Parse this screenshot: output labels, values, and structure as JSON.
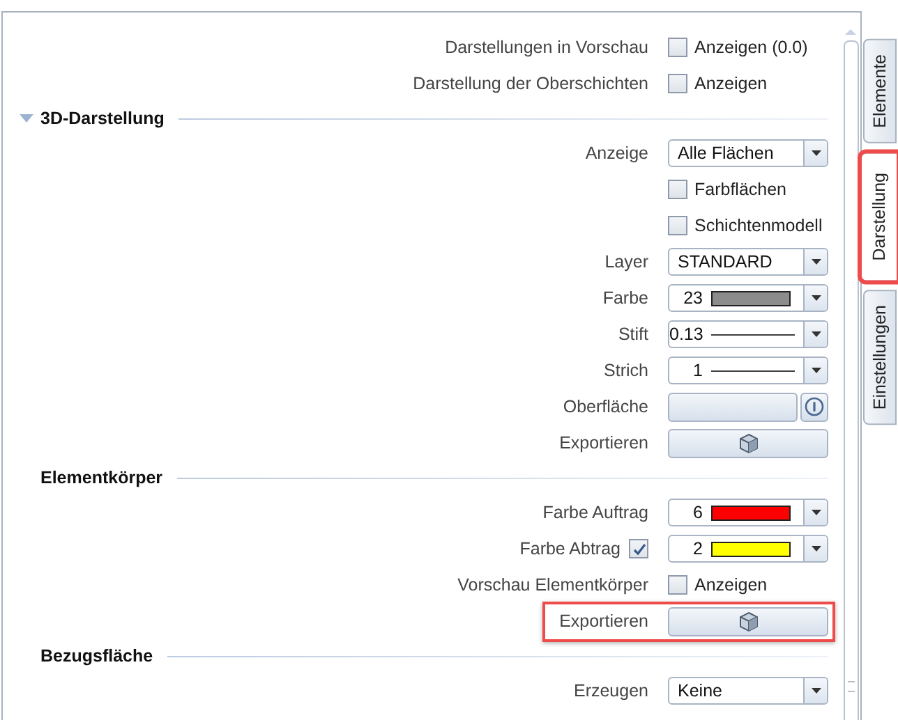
{
  "sections": [
    {
      "rows": [
        {
          "kind": "check",
          "label": "Darstellungen in Vorschau",
          "check_label": "Anzeigen (0.0)",
          "checked": false
        },
        {
          "kind": "check",
          "label": "Darstellung der Oberschichten",
          "check_label": "Anzeigen",
          "checked": false
        }
      ]
    },
    {
      "title": "3D-Darstellung",
      "expanded": true,
      "rows": [
        {
          "kind": "dropdown",
          "label": "Anzeige",
          "value": "Alle Flächen"
        },
        {
          "kind": "check",
          "check_label": "Farbflächen",
          "checked": false
        },
        {
          "kind": "check",
          "check_label": "Schichtenmodell",
          "checked": false
        },
        {
          "kind": "dropdown",
          "label": "Layer",
          "value": "STANDARD"
        },
        {
          "kind": "color",
          "label": "Farbe",
          "value": "23",
          "color": "#8c8c8c"
        },
        {
          "kind": "line",
          "label": "Stift",
          "value": "0.13"
        },
        {
          "kind": "line",
          "label": "Strich",
          "value": "1"
        },
        {
          "kind": "surface",
          "label": "Oberfläche"
        },
        {
          "kind": "export",
          "label": "Exportieren",
          "highlighted": false
        }
      ]
    },
    {
      "title": "Elementkörper",
      "rows": [
        {
          "kind": "color",
          "label": "Farbe Auftrag",
          "value": "6",
          "color": "#ff0000"
        },
        {
          "kind": "color",
          "label": "Farbe Abtrag",
          "value": "2",
          "color": "#ffff00",
          "label_checked": true
        },
        {
          "kind": "check",
          "label": "Vorschau Elementkörper",
          "check_label": "Anzeigen",
          "checked": false
        },
        {
          "kind": "export",
          "label": "Exportieren",
          "highlighted": true
        }
      ]
    },
    {
      "title": "Bezugsfläche",
      "rows": [
        {
          "kind": "dropdown",
          "label": "Erzeugen",
          "value": "Keine"
        }
      ]
    }
  ],
  "tabs": [
    {
      "label": "Elemente",
      "selected": false,
      "highlighted": false
    },
    {
      "label": "Darstellung",
      "selected": true,
      "highlighted": true
    },
    {
      "label": "Einstellungen",
      "selected": false,
      "highlighted": false
    }
  ]
}
